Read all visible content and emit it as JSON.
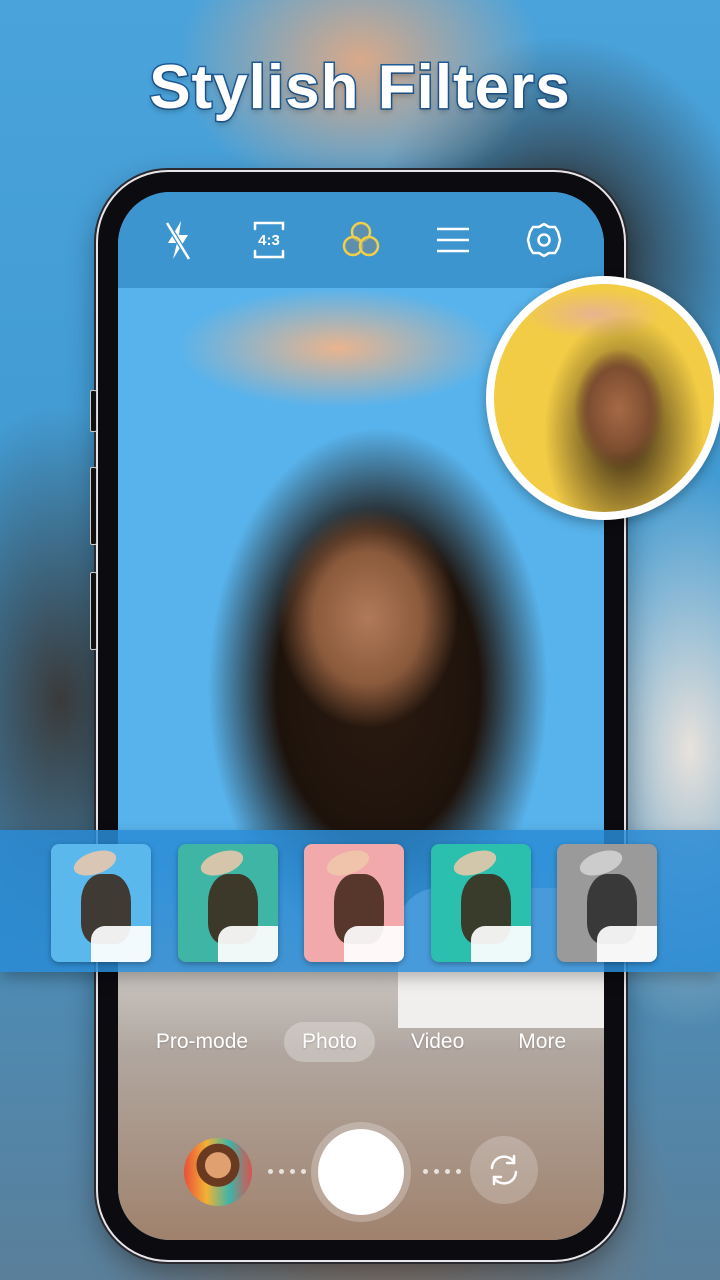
{
  "headline": "Stylish Filters",
  "colors": {
    "accent_blue": "#3d95cf",
    "filter_strip": "#2a8cd6",
    "active_filter_icon": "#f2cf4a",
    "headline_stroke": "#1f5d9a"
  },
  "topbar": {
    "icons": [
      {
        "name": "flash-off-icon",
        "label": "Flash off"
      },
      {
        "name": "aspect-ratio-icon",
        "label": "4:3"
      },
      {
        "name": "filters-icon",
        "label": "Filters",
        "active": true
      },
      {
        "name": "menu-icon",
        "label": "Menu"
      },
      {
        "name": "settings-icon",
        "label": "Settings"
      }
    ]
  },
  "filters": [
    {
      "name": "original",
      "tint": "#5ab8ec"
    },
    {
      "name": "teal-pink",
      "tint": "#3fb5a5"
    },
    {
      "name": "pink",
      "tint": "#f2a9ab"
    },
    {
      "name": "vivid-teal",
      "tint": "#2bbfae"
    },
    {
      "name": "mono",
      "tint": "#9a9a9a"
    }
  ],
  "modes": [
    {
      "label": "Pro-mode",
      "active": false
    },
    {
      "label": "Photo",
      "active": true
    },
    {
      "label": "Video",
      "active": false
    },
    {
      "label": "More",
      "active": false
    }
  ],
  "preview_filter_tint": "#f2cc45"
}
